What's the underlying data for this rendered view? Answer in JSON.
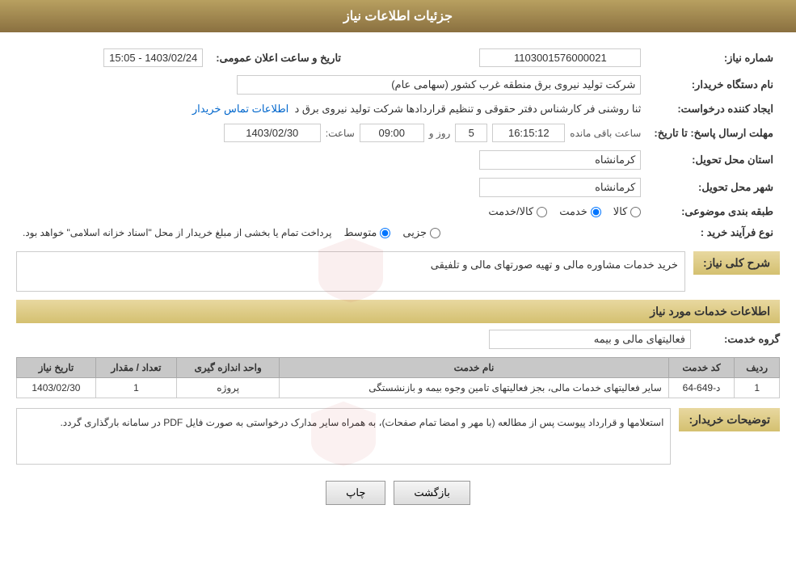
{
  "header": {
    "title": "جزئیات اطلاعات نیاز"
  },
  "fields": {
    "need_number_label": "شماره نیاز:",
    "need_number_value": "1103001576000021",
    "announce_date_label": "تاریخ و ساعت اعلان عمومی:",
    "announce_date_value": "1403/02/24 - 15:05",
    "buyer_org_label": "نام دستگاه خریدار:",
    "buyer_org_value": "شرکت تولید نیروی برق منطقه غرب کشور (سهامی عام)",
    "creator_label": "ایجاد کننده درخواست:",
    "creator_value": "ثنا روشنی فر کارشناس دفتر حقوقی و تنظیم قراردادها شرکت تولید نیروی برق د",
    "creator_link": "اطلاعات تماس خریدار",
    "deadline_label": "مهلت ارسال پاسخ: تا تاریخ:",
    "deadline_date": "1403/02/30",
    "deadline_time_label": "ساعت:",
    "deadline_time": "09:00",
    "deadline_day_label": "روز و",
    "deadline_days": "5",
    "deadline_remaining_label": "ساعت باقی مانده",
    "deadline_remaining": "16:15:12",
    "province_label": "استان محل تحویل:",
    "province_value": "کرمانشاه",
    "city_label": "شهر محل تحویل:",
    "city_value": "کرمانشاه",
    "category_label": "طبقه بندی موضوعی:",
    "category_options": [
      {
        "label": "کالا",
        "value": "kala"
      },
      {
        "label": "خدمت",
        "value": "khedmat"
      },
      {
        "label": "کالا/خدمت",
        "value": "kala_khedmat"
      }
    ],
    "category_selected": "khedmat",
    "purchase_type_label": "نوع فرآیند خرید :",
    "purchase_options": [
      {
        "label": "جزیی",
        "value": "jozii"
      },
      {
        "label": "متوسط",
        "value": "motevaset"
      }
    ],
    "purchase_note": "پرداخت تمام یا بخشی از مبلغ خریدار از محل \"اسناد خزانه اسلامی\" خواهد بود.",
    "need_description_label": "شرح کلی نیاز:",
    "need_description": "خرید خدمات مشاوره مالی و تهیه صورتهای مالی و تلفیقی",
    "services_section_label": "اطلاعات خدمات مورد نیاز",
    "service_group_label": "گروه خدمت:",
    "service_group_value": "فعالیتهای مالی و بیمه",
    "table": {
      "headers": [
        "ردیف",
        "کد خدمت",
        "نام خدمت",
        "واحد اندازه گیری",
        "تعداد / مقدار",
        "تاریخ نیاز"
      ],
      "rows": [
        {
          "row": "1",
          "code": "د-649-64",
          "name": "سایر فعالیتهای خدمات مالی، بجز فعالیتهای تامین وجوه بیمه و بازنشستگی",
          "unit": "پروژه",
          "quantity": "1",
          "date": "1403/02/30"
        }
      ]
    },
    "buyer_desc_label": "توضیحات خریدار:",
    "buyer_desc_value": "استعلامها و قرارداد پیوست پس از مطالعه (با مهر و امضا تمام صفحات)، به همراه سایر مدارک درخواستی به صورت فایل PDF در سامانه بارگذاری گردد."
  },
  "buttons": {
    "print_label": "چاپ",
    "back_label": "بازگشت"
  }
}
